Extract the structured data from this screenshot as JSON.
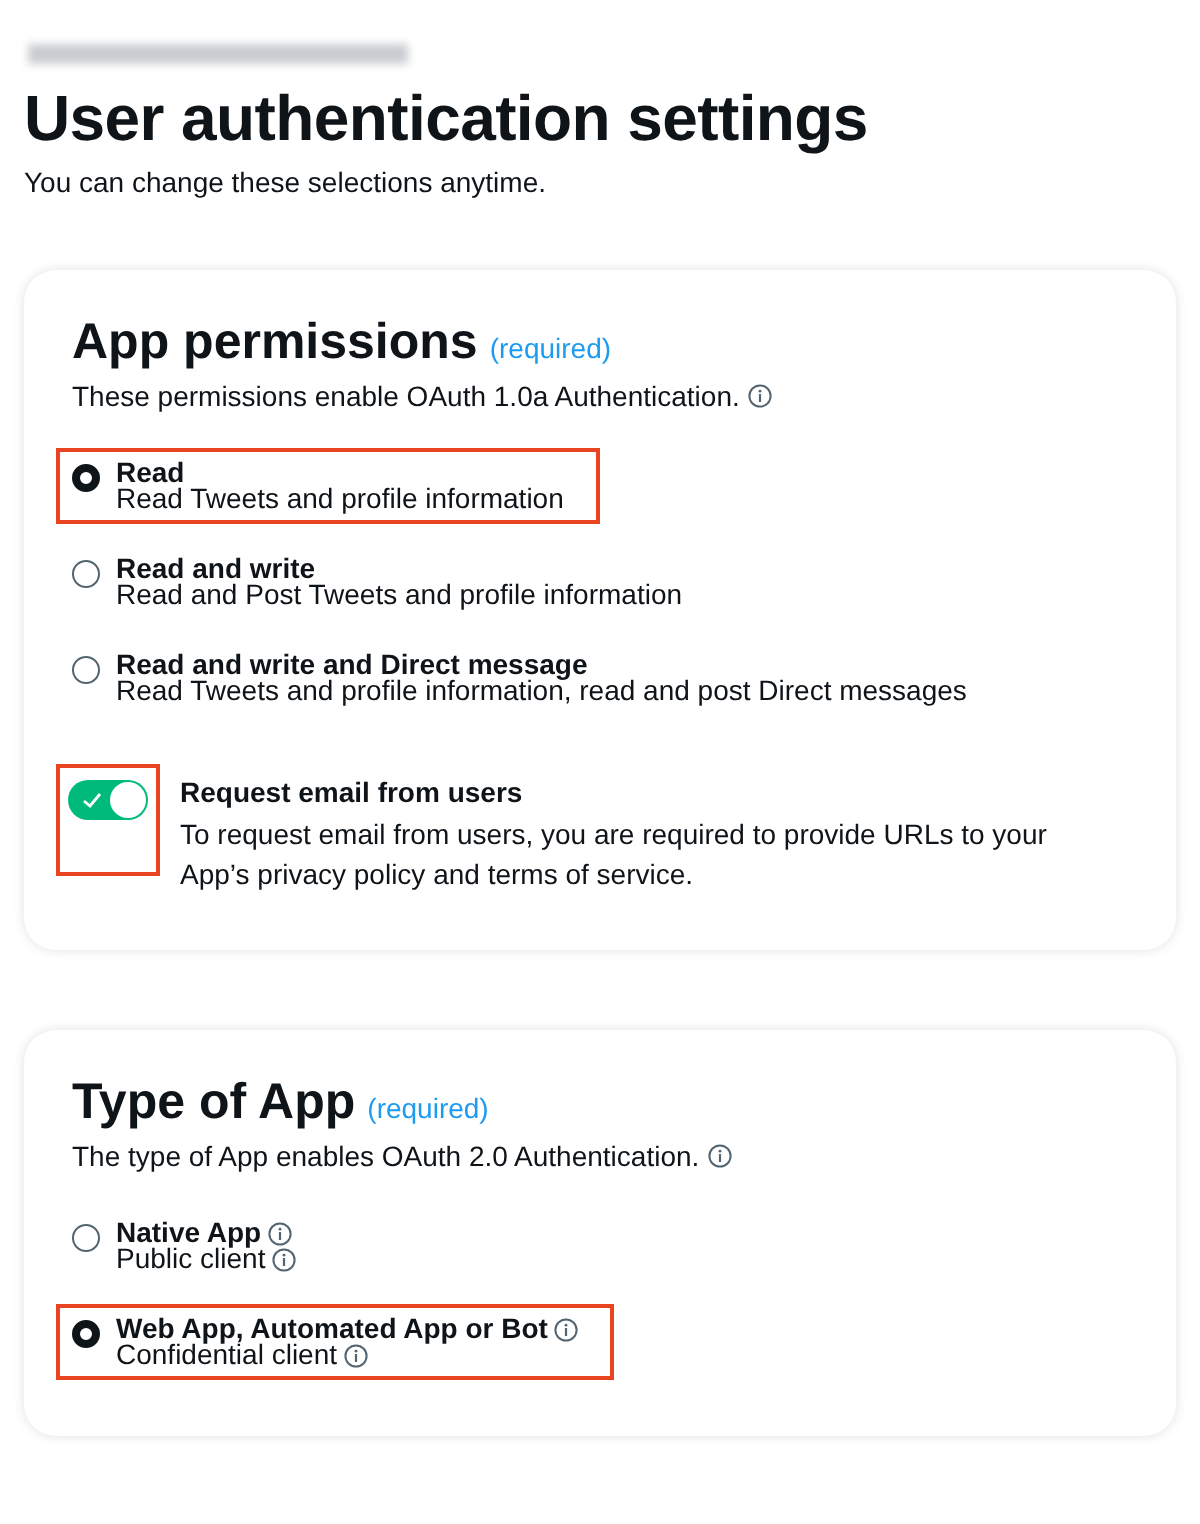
{
  "page": {
    "title": "User authentication settings",
    "subtitle": "You can change these selections anytime."
  },
  "sections": [
    {
      "title": "App permissions",
      "required": "(required)",
      "description": "These permissions enable OAuth 1.0a Authentication.",
      "info": true,
      "options": [
        {
          "label": "Read",
          "description": "Read Tweets and profile information",
          "selected": true,
          "highlighted": true,
          "label_info": false,
          "description_info": false
        },
        {
          "label": "Read and write",
          "description": "Read and Post Tweets and profile information",
          "selected": false,
          "highlighted": false,
          "label_info": false,
          "description_info": false
        },
        {
          "label": "Read and write and Direct message",
          "description": "Read Tweets and profile information, read and post Direct messages",
          "selected": false,
          "highlighted": false,
          "label_info": false,
          "description_info": false
        }
      ],
      "toggle": {
        "label": "Request email from users",
        "description": "To request email from users, you are required to provide URLs to your App’s privacy policy and terms of service.",
        "on": true,
        "highlighted": true
      }
    },
    {
      "title": "Type of App",
      "required": "(required)",
      "description": "The type of App enables OAuth 2.0 Authentication.",
      "info": true,
      "options": [
        {
          "label": "Native App",
          "description": "Public client",
          "selected": false,
          "highlighted": false,
          "label_info": true,
          "description_info": true
        },
        {
          "label": "Web App, Automated App or Bot",
          "description": "Confidential client",
          "selected": true,
          "highlighted": true,
          "label_info": true,
          "description_info": true
        }
      ]
    }
  ]
}
